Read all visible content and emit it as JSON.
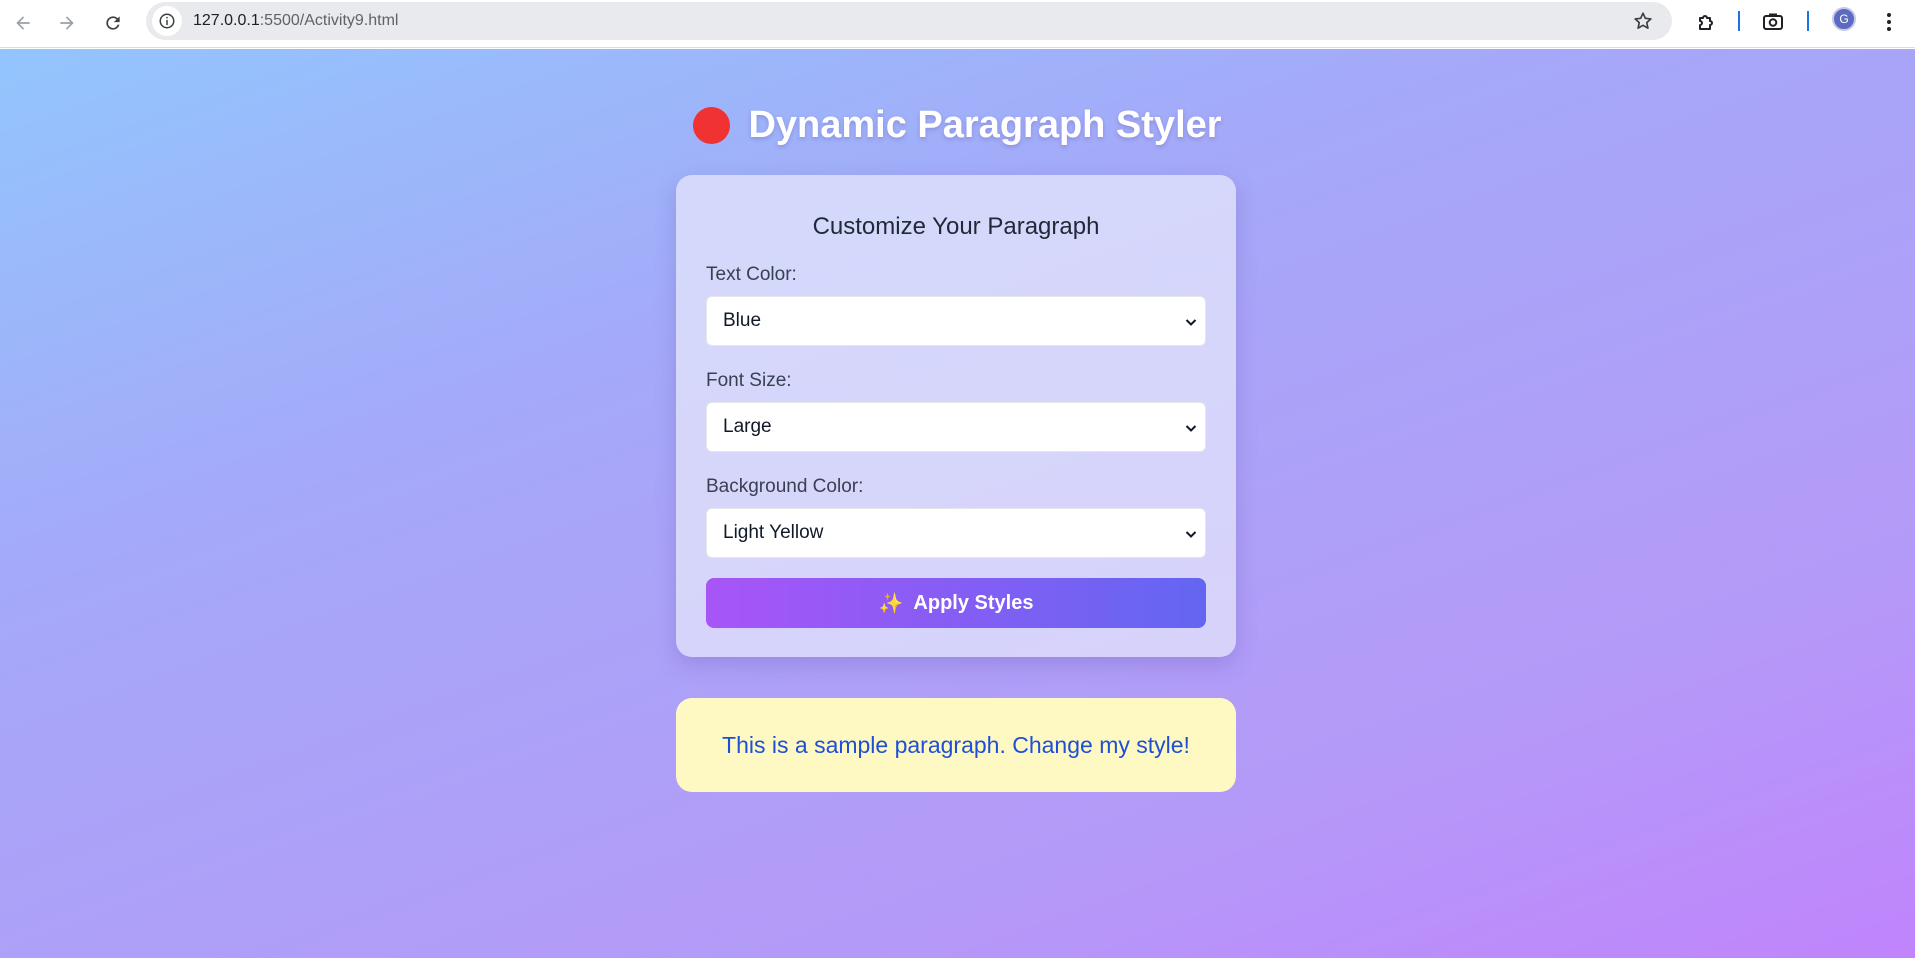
{
  "browser": {
    "url_host": "127.0.0.1",
    "url_rest": ":5500/Activity9.html",
    "profile_initial": "G"
  },
  "page": {
    "title": "Dynamic Paragraph Styler",
    "title_icon": "red-circle-icon",
    "title_icon_color": "#f03232"
  },
  "form": {
    "heading": "Customize Your Paragraph",
    "text_color_label": "Text Color:",
    "text_color_value": "Blue",
    "font_size_label": "Font Size:",
    "font_size_value": "Large",
    "bg_color_label": "Background Color:",
    "bg_color_value": "Light Yellow",
    "apply_icon": "✨",
    "apply_label": "Apply Styles"
  },
  "preview": {
    "text": "This is a sample paragraph. Change my style!",
    "text_color": "#1e4fd6",
    "background": "#fef9c3"
  },
  "colors": {
    "button_gradient_start": "#a855f7",
    "button_gradient_end": "#6366f1"
  }
}
